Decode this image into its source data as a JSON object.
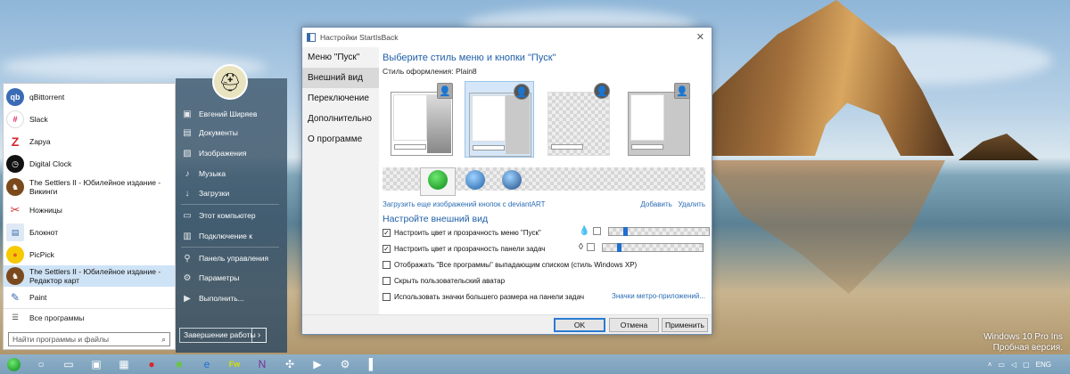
{
  "desktop": {
    "watermark_line1": "Windows 10 Pro Ins",
    "watermark_line2": "Пробная версия."
  },
  "start_menu": {
    "apps": [
      {
        "label": "qBittorrent",
        "icon": "qbittorrent-icon",
        "color": "#3a6bb4",
        "glyph": "qb"
      },
      {
        "label": "Slack",
        "icon": "slack-icon",
        "color": "#ffffff",
        "glyph": ""
      },
      {
        "label": "Zapya",
        "icon": "zapya-icon",
        "color": "#ffffff",
        "glyph": "Z"
      },
      {
        "label": "Digital Clock",
        "icon": "clock-icon",
        "color": "#111111",
        "glyph": "◷"
      },
      {
        "label": "The Settlers II - Юбилейное издание - Викинги",
        "icon": "settlers-icon",
        "color": "#7a4a1d",
        "glyph": "♞"
      },
      {
        "label": "Ножницы",
        "icon": "scissors-icon",
        "color": "#ffffff",
        "glyph": "✂"
      },
      {
        "label": "Блокнот",
        "icon": "notepad-icon",
        "color": "#ffffff",
        "glyph": "▤"
      },
      {
        "label": "PicPick",
        "icon": "picpick-icon",
        "color": "#f6c900",
        "glyph": "●"
      },
      {
        "label": "The Settlers II - Юбилейное издание - Редактор карт",
        "icon": "settlers-editor-icon",
        "color": "#7a4a1d",
        "glyph": "♞"
      },
      {
        "label": "Paint",
        "icon": "paint-icon",
        "color": "#ffffff",
        "glyph": "🎨"
      }
    ],
    "all_programs": "Все программы",
    "search_placeholder": "Найти программы и файлы",
    "places": [
      "Евгений Ширяев",
      "Документы",
      "Изображения",
      "Музыка",
      "Загрузки",
      "Этот компьютер",
      "Подключение к",
      "Панель управления",
      "Параметры",
      "Выполнить..."
    ],
    "shutdown": "Завершение работы",
    "shutdown_arrow": "›"
  },
  "dialog": {
    "title": "Настройки StartIsBack",
    "close": "✕",
    "nav": [
      "Меню \"Пуск\"",
      "Внешний вид",
      "Переключение",
      "Дополнительно",
      "О программе"
    ],
    "heading": "Выберите стиль меню и кнопки \"Пуск\"",
    "style_label": "Стиль оформления:",
    "style_value": "Plain8",
    "download_link": "Загрузить еще изображений кнопок с deviantART",
    "add_link": "Добавить",
    "remove_link": "Удалить",
    "section2": "Настройте внешний вид",
    "options": [
      {
        "label": "Настроить цвет и прозрачность меню \"Пуск\"",
        "checked": true
      },
      {
        "label": "Настроить цвет и прозрачность панели задач",
        "checked": true
      },
      {
        "label": "Отображать \"Все программы\" выпадающим списком (стиль Windows XP)",
        "checked": false
      },
      {
        "label": "Скрыть пользовательский аватар",
        "checked": false
      },
      {
        "label": "Использовать значки большего размера на панели задач",
        "checked": false
      }
    ],
    "metro_link": "Значки метро-приложений...",
    "buttons": {
      "ok": "OK",
      "cancel": "Отмена",
      "apply": "Применить"
    },
    "accent": "#1f5fa8"
  },
  "taskbar": {
    "tray_lang": "ENG",
    "time": "",
    "icons": [
      "start-orb-icon",
      "search-icon",
      "task-view-icon",
      "explorer-icon",
      "store-icon",
      "opera-icon",
      "feed-icon",
      "edge-icon",
      "fireworks-icon",
      "onenote-icon",
      "puzzle-icon",
      "media-icon",
      "settings-icon",
      "app-icon"
    ]
  }
}
